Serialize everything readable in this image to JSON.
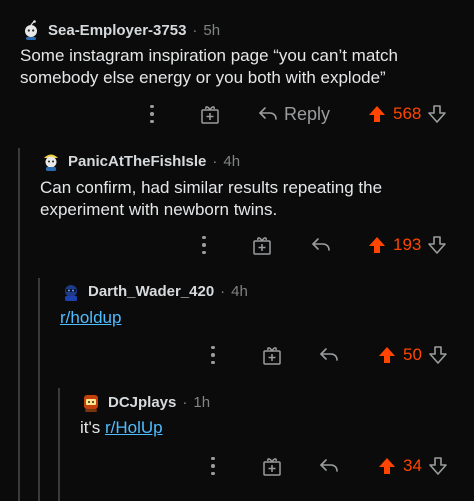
{
  "colors": {
    "background": "#0b0b0b",
    "upvoted": "#ff4500",
    "link": "#4fbcff",
    "muted": "#818384"
  },
  "comments": [
    {
      "username": "Sea-Employer-3753",
      "separator": "·",
      "time": "5h",
      "text": "Some instagram inspiration page “you can’t match somebody else energy or you both with explode”",
      "reply_label": "Reply",
      "score": "568"
    },
    {
      "username": "PanicAtTheFishIsle",
      "separator": "·",
      "time": "4h",
      "text": "Can confirm, had similar results repeating the experiment with newborn twins.",
      "score": "193"
    },
    {
      "username": "Darth_Wader_420",
      "separator": "·",
      "time": "4h",
      "link_text": "r/holdup",
      "score": "50"
    },
    {
      "username": "DCJplays",
      "separator": "·",
      "time": "1h",
      "text_prefix": "it's ",
      "link_text": "r/HolUp",
      "score": "34"
    }
  ]
}
